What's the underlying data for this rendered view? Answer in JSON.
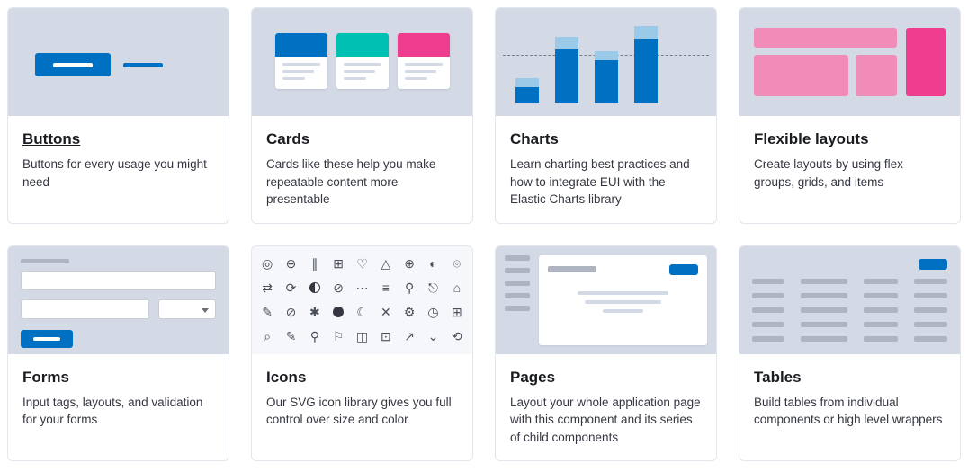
{
  "cards": [
    {
      "title": "Buttons",
      "desc": "Buttons for every usage you might need"
    },
    {
      "title": "Cards",
      "desc": "Cards like these help you make repeatable content more presentable"
    },
    {
      "title": "Charts",
      "desc": "Learn charting best practices and how to integrate EUI with the Elastic Charts library"
    },
    {
      "title": "Flexible layouts",
      "desc": "Create layouts by using flex groups, grids, and items"
    },
    {
      "title": "Forms",
      "desc": "Input tags, layouts, and validation for your forms"
    },
    {
      "title": "Icons",
      "desc": "Our SVG icon library gives you full control over size and color"
    },
    {
      "title": "Pages",
      "desc": "Layout your whole application page with this component and its series of child components"
    },
    {
      "title": "Tables",
      "desc": "Build tables from individual components or high level wrappers"
    }
  ]
}
